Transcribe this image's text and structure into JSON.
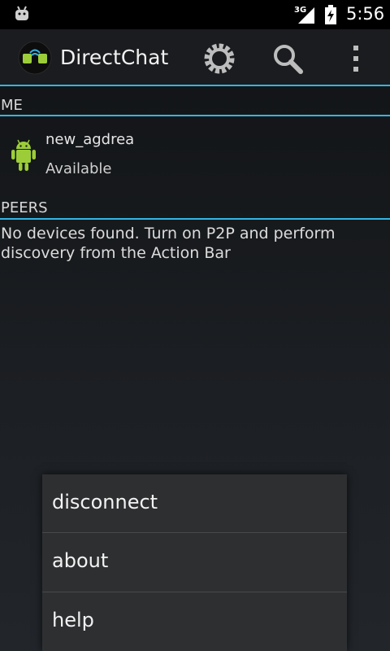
{
  "status_bar": {
    "network": "3G",
    "time": "5:56",
    "icons": [
      "android-debug-icon",
      "signal-icon",
      "battery-icon"
    ]
  },
  "action_bar": {
    "title": "DirectChat",
    "actions": [
      {
        "name": "settings",
        "icon": "gear-icon"
      },
      {
        "name": "search",
        "icon": "search-icon"
      },
      {
        "name": "overflow",
        "icon": "overflow-menu-icon"
      }
    ],
    "accent_color": "#33b5e5"
  },
  "me": {
    "header": "ME",
    "device_name": "new_agdrea",
    "device_status": "Available"
  },
  "peers": {
    "header": "PEERS",
    "empty_message": "No devices found. Turn on P2P and perform discovery from the Action Bar"
  },
  "menu": {
    "items": [
      {
        "label": "disconnect"
      },
      {
        "label": "about"
      },
      {
        "label": "help"
      }
    ]
  }
}
